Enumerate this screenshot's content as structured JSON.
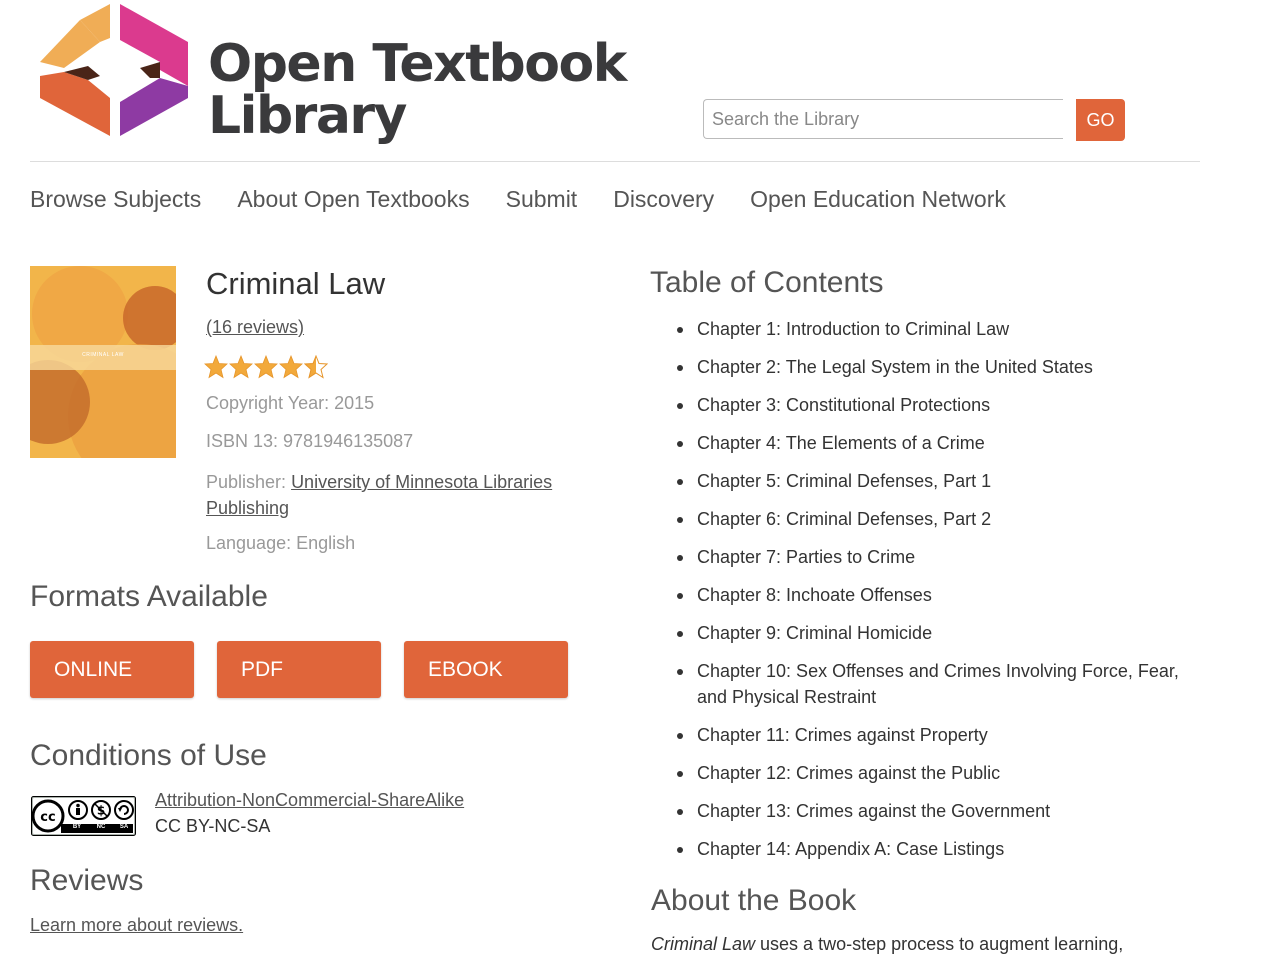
{
  "brand": {
    "name_line1": "Open Textbook",
    "name_line2": "Library"
  },
  "search": {
    "placeholder": "Search the Library",
    "button_label": "GO"
  },
  "nav": {
    "items": [
      "Browse Subjects",
      "About Open Textbooks",
      "Submit",
      "Discovery",
      "Open Education Network"
    ]
  },
  "book": {
    "cover_text": "CRIMINAL LAW",
    "title": "Criminal Law",
    "reviews": "(16 reviews)",
    "rating": 4.5,
    "rating_max": 5,
    "copyright": "Copyright Year: 2015",
    "isbn": "ISBN 13: 9781946135087",
    "publisher_label": "Publisher:",
    "publisher_line1": "University of Minnesota Libraries",
    "publisher_line2": "Publishing",
    "language": "Language: English"
  },
  "formats": {
    "heading": "Formats Available",
    "buttons": [
      "ONLINE",
      "PDF",
      "EBOOK"
    ]
  },
  "conditions": {
    "heading": "Conditions of Use",
    "license_name": "Attribution-NonCommercial-ShareAlike",
    "license_code": "CC BY-NC-SA",
    "badge_labels": [
      "BY",
      "NC",
      "SA"
    ]
  },
  "reviews": {
    "heading": "Reviews",
    "learn_more": "Learn more about reviews."
  },
  "toc": {
    "heading": "Table of Contents",
    "chapters": [
      "Chapter 1: Introduction to Criminal Law",
      "Chapter 2: The Legal System in the United States",
      "Chapter 3: Constitutional Protections",
      "Chapter 4: The Elements of a Crime",
      "Chapter 5: Criminal Defenses, Part 1",
      "Chapter 6: Criminal Defenses, Part 2",
      "Chapter 7: Parties to Crime",
      "Chapter 8: Inchoate Offenses",
      "Chapter 9: Criminal Homicide",
      "Chapter 10: Sex Offenses and Crimes Involving Force, Fear, and Physical Restraint",
      "Chapter 11: Crimes against Property",
      "Chapter 12: Crimes against the Public",
      "Chapter 13: Crimes against the Government",
      "Chapter 14: Appendix A: Case Listings"
    ]
  },
  "about": {
    "heading": "About the Book",
    "intro_title": "Criminal Law",
    "intro_rest": " uses a two-step process to augment learning,"
  },
  "colors": {
    "accent": "#e0653a",
    "text": "#333333",
    "muted": "#999999"
  }
}
